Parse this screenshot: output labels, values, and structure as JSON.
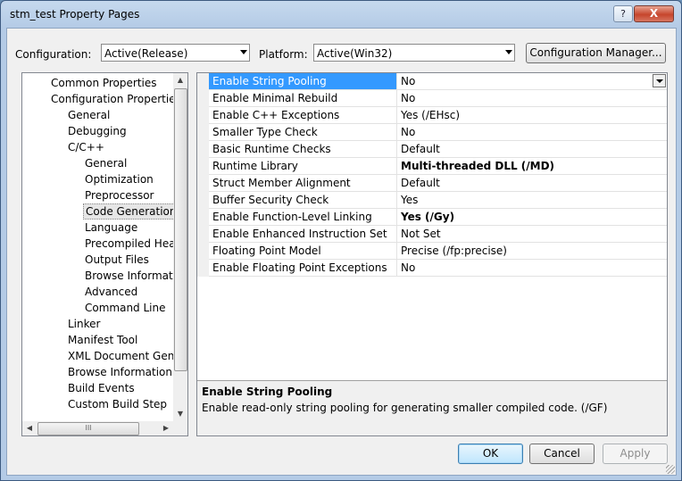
{
  "window": {
    "title": "stm_test Property Pages",
    "help_glyph": "?",
    "close_glyph": "X"
  },
  "toolbar": {
    "configuration_label": "Configuration:",
    "configuration_value": "Active(Release)",
    "platform_label": "Platform:",
    "platform_value": "Active(Win32)",
    "config_manager_label": "Configuration Manager..."
  },
  "tree": {
    "items": [
      {
        "label": "Common Properties",
        "level": 1
      },
      {
        "label": "Configuration Properties",
        "level": 1
      },
      {
        "label": "General",
        "level": 2
      },
      {
        "label": "Debugging",
        "level": 2
      },
      {
        "label": "C/C++",
        "level": 2
      },
      {
        "label": "General",
        "level": 3
      },
      {
        "label": "Optimization",
        "level": 3
      },
      {
        "label": "Preprocessor",
        "level": 3
      },
      {
        "label": "Code Generation",
        "level": 3,
        "selected": true
      },
      {
        "label": "Language",
        "level": 3
      },
      {
        "label": "Precompiled Heade",
        "level": 3
      },
      {
        "label": "Output Files",
        "level": 3
      },
      {
        "label": "Browse Information",
        "level": 3
      },
      {
        "label": "Advanced",
        "level": 3
      },
      {
        "label": "Command Line",
        "level": 3
      },
      {
        "label": "Linker",
        "level": 2
      },
      {
        "label": "Manifest Tool",
        "level": 2
      },
      {
        "label": "XML Document Genera",
        "level": 2
      },
      {
        "label": "Browse Information",
        "level": 2
      },
      {
        "label": "Build Events",
        "level": 2
      },
      {
        "label": "Custom Build Step",
        "level": 2
      }
    ],
    "hscroll_grip": "III"
  },
  "properties": {
    "rows": [
      {
        "name": "Enable String Pooling",
        "value": "No",
        "bold": false
      },
      {
        "name": "Enable Minimal Rebuild",
        "value": "No",
        "bold": false
      },
      {
        "name": "Enable C++ Exceptions",
        "value": "Yes (/EHsc)",
        "bold": false
      },
      {
        "name": "Smaller Type Check",
        "value": "No",
        "bold": false
      },
      {
        "name": "Basic Runtime Checks",
        "value": "Default",
        "bold": false
      },
      {
        "name": "Runtime Library",
        "value": "Multi-threaded DLL (/MD)",
        "bold": true
      },
      {
        "name": "Struct Member Alignment",
        "value": "Default",
        "bold": false
      },
      {
        "name": "Buffer Security Check",
        "value": "Yes",
        "bold": false
      },
      {
        "name": "Enable Function-Level Linking",
        "value": "Yes (/Gy)",
        "bold": true
      },
      {
        "name": "Enable Enhanced Instruction Set",
        "value": "Not Set",
        "bold": false
      },
      {
        "name": "Floating Point Model",
        "value": "Precise (/fp:precise)",
        "bold": false
      },
      {
        "name": "Enable Floating Point Exceptions",
        "value": "No",
        "bold": false
      }
    ],
    "selected_index": 0
  },
  "description": {
    "title": "Enable String Pooling",
    "text": "Enable read-only string pooling for generating smaller compiled code.     (/GF)"
  },
  "buttons": {
    "ok": "OK",
    "cancel": "Cancel",
    "apply": "Apply"
  },
  "colors": {
    "selection": "#3399ff",
    "title_bar": "#b4cbe6",
    "close_button": "#c6452c"
  }
}
